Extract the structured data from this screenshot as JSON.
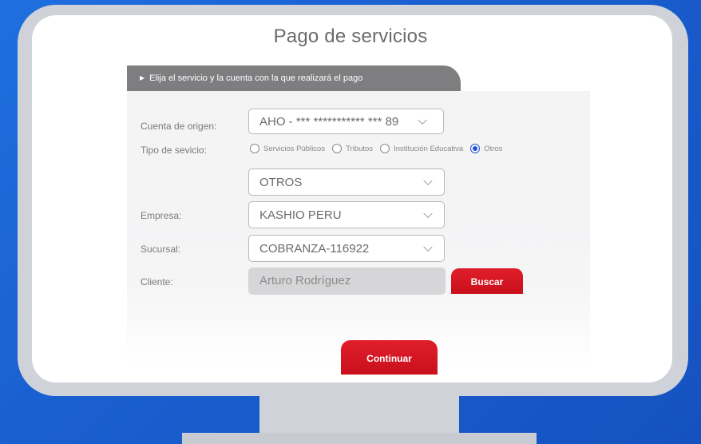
{
  "title": "Pago de servicios",
  "instruction": "Elija el servicio y la cuenta con la que realizará el pago",
  "form": {
    "cuenta_label": "Cuenta de origen:",
    "cuenta_value": "AHO - *** *********** *** 89",
    "tipo_label": "Tipo de sevicio:",
    "tipo_options": [
      {
        "label": "Servicios Públicos",
        "checked": false
      },
      {
        "label": "Tributos",
        "checked": false
      },
      {
        "label": "Institución Educativa",
        "checked": false
      },
      {
        "label": "Otros",
        "checked": true
      }
    ],
    "tipo_select_value": "OTROS",
    "empresa_label": "Empresa:",
    "empresa_value": "KASHIO PERU",
    "sucursal_label": "Sucursal:",
    "sucursal_value": "COBRANZA-116922",
    "cliente_label": "Cliente:",
    "cliente_value": "Arturo Rodríguez",
    "buscar_label": "Buscar",
    "continuar_label": "Continuar"
  },
  "colors": {
    "background": "#1a5fd0",
    "accent_red": "#d5131f",
    "radio_selected": "#1d4fd8",
    "tab_gray": "#7e7e80"
  }
}
